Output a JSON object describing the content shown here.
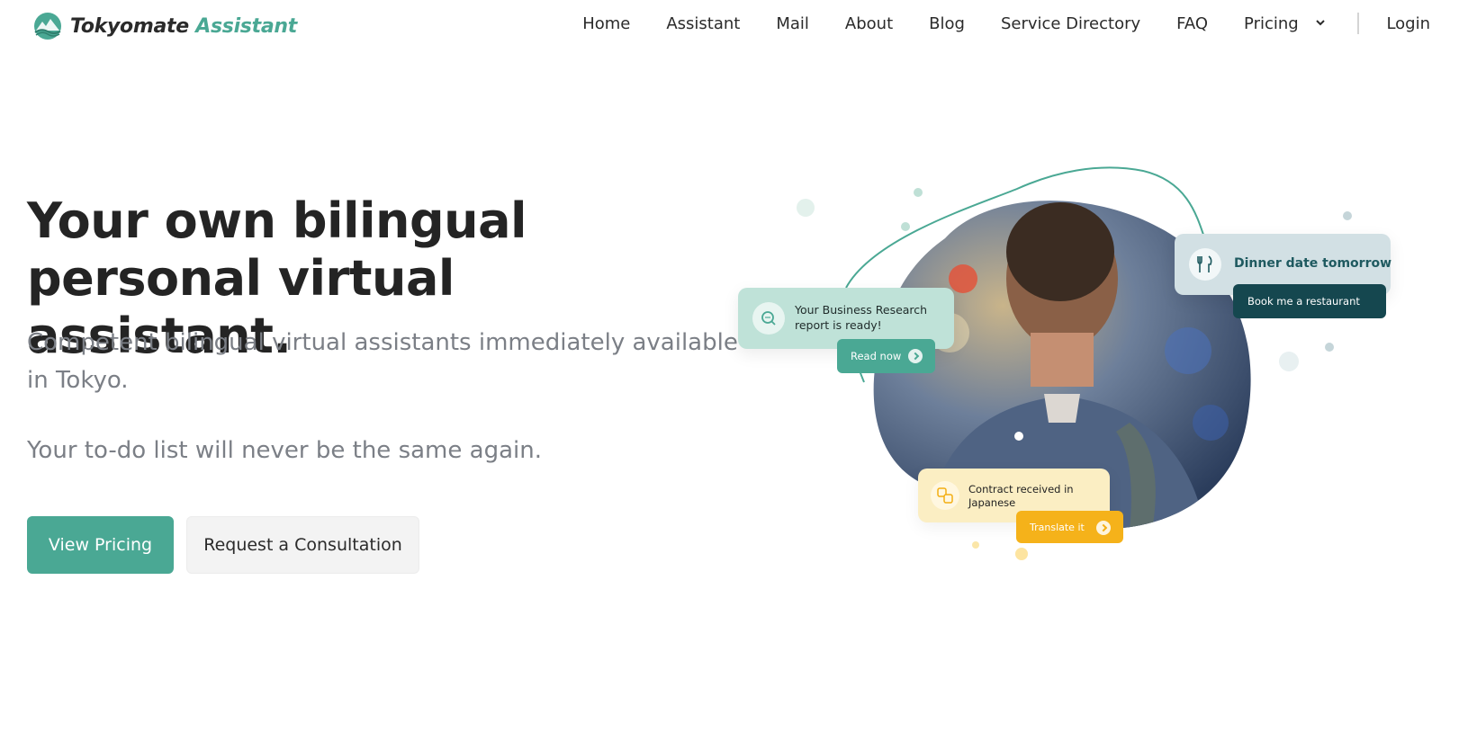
{
  "brand": {
    "name_dark": "Tokyomate",
    "name_accent": "Assistant",
    "logo_icon": "mountain-wave-logo-icon",
    "accent_color": "#4aa894"
  },
  "nav": {
    "items": [
      "Home",
      "Assistant",
      "Mail",
      "About",
      "Blog",
      "Service Directory",
      "FAQ"
    ],
    "pricing": "Pricing",
    "login": "Login"
  },
  "hero": {
    "title": "Your own bilingual personal virtual assistant.",
    "subtitle": "Competent bilingual virtual assistants immediately available in Tokyo.",
    "tagline": "Your to-do list will never be the same again.",
    "primary_button": "View Pricing",
    "secondary_button": "Request a Consultation"
  },
  "illustration": {
    "research_card": {
      "text": "Your Business Research report is ready!",
      "button": "Read now",
      "icon": "chat-search-icon"
    },
    "dinner_card": {
      "text": "Dinner date tomorrow",
      "button": "Book me a restaurant",
      "icon": "fork-knife-icon"
    },
    "contract_card": {
      "text": "Contract received in Japanese",
      "button": "Translate it",
      "icon": "translate-icon"
    }
  }
}
